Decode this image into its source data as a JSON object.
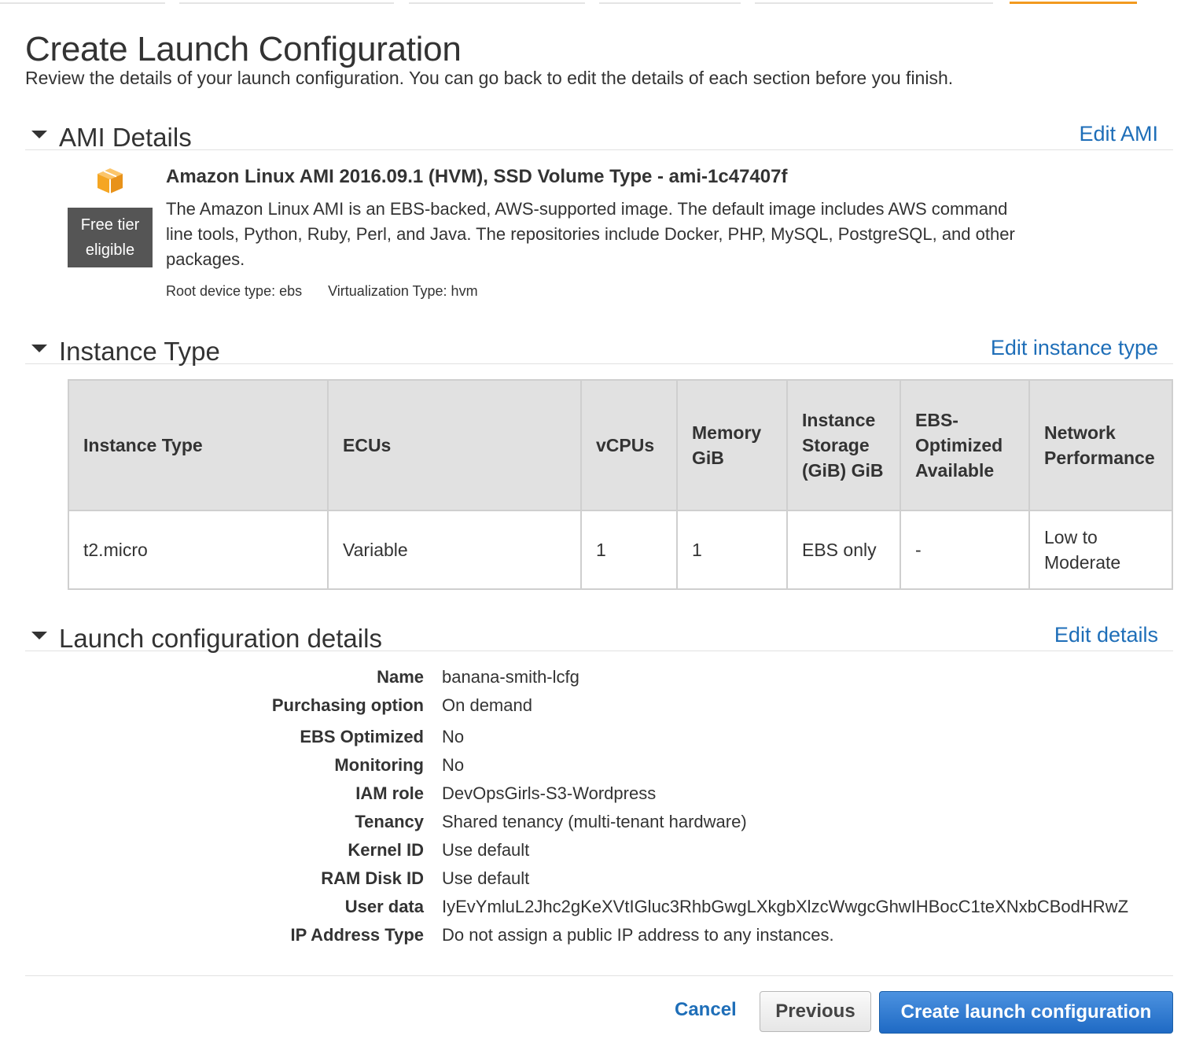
{
  "page": {
    "title": "Create Launch Configuration",
    "subtitle": "Review the details of your launch configuration. You can go back to edit the details of each section before you finish."
  },
  "ami": {
    "section_title": "AMI Details",
    "edit_label": "Edit AMI",
    "badge_line1": "Free tier",
    "badge_line2": "eligible",
    "name": "Amazon Linux AMI 2016.09.1 (HVM), SSD Volume Type - ami-1c47407f",
    "description": "The Amazon Linux AMI is an EBS-backed, AWS-supported image. The default image includes AWS command line tools, Python, Ruby, Perl, and Java. The repositories include Docker, PHP, MySQL, PostgreSQL, and other packages.",
    "root_device": "Root device type: ebs",
    "virtualization": "Virtualization Type: hvm",
    "icon": "cube-icon",
    "icon_color": "#f5a623"
  },
  "instance": {
    "section_title": "Instance Type",
    "edit_label": "Edit instance type",
    "headers": [
      "Instance Type",
      "ECUs",
      "vCPUs",
      "Memory GiB",
      "Instance Storage (GiB) GiB",
      "EBS-Optimized Available",
      "Network Performance"
    ],
    "row": [
      "t2.micro",
      "Variable",
      "1",
      "1",
      "EBS only",
      "-",
      "Low to Moderate"
    ]
  },
  "details": {
    "section_title": "Launch configuration details",
    "edit_label": "Edit details",
    "rows": [
      {
        "label": "Name",
        "value": "banana-smith-lcfg"
      },
      {
        "label": "Purchasing option",
        "value": "On demand"
      },
      {
        "label": "EBS Optimized",
        "value": "No"
      },
      {
        "label": "Monitoring",
        "value": "No"
      },
      {
        "label": "IAM role",
        "value": "DevOpsGirls-S3-Wordpress"
      },
      {
        "label": "Tenancy",
        "value": "Shared tenancy (multi-tenant hardware)"
      },
      {
        "label": "Kernel ID",
        "value": "Use default"
      },
      {
        "label": "RAM Disk ID",
        "value": "Use default"
      },
      {
        "label": "User data",
        "value": "IyEvYmluL2Jhc2gKeXVtIGluc3RhbGwgLXkgbXlzcWwgcGhwIHBocC1teXNxbCBodHRwZ"
      },
      {
        "label": "IP Address Type",
        "value": "Do not assign a public IP address to any instances."
      }
    ]
  },
  "footer": {
    "cancel_label": "Cancel",
    "previous_label": "Previous",
    "create_label": "Create launch configuration"
  },
  "colors": {
    "link": "#1e6eb8",
    "primary_button": "#2a73c9",
    "active_step": "#f29a1f"
  }
}
